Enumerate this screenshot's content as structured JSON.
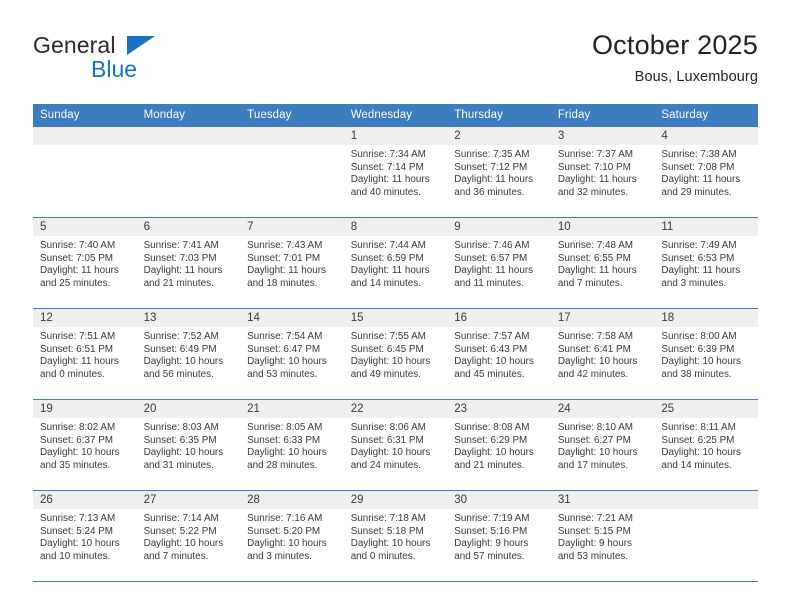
{
  "brand": {
    "name_part1": "General",
    "name_part2": "Blue",
    "triangle_icon": "triangle-icon",
    "accent_color": "#1a72c0"
  },
  "header": {
    "title": "October 2025",
    "subtitle": "Bous, Luxembourg"
  },
  "theme": {
    "header_blue": "#3c7cbf",
    "daynum_band": "#efefef",
    "text": "#3a3a3a"
  },
  "weekdays": [
    "Sunday",
    "Monday",
    "Tuesday",
    "Wednesday",
    "Thursday",
    "Friday",
    "Saturday"
  ],
  "labels": {
    "sunrise": "Sunrise:",
    "sunset": "Sunset:",
    "daylight": "Daylight:"
  },
  "weeks": [
    [
      {
        "day": "",
        "empty": true
      },
      {
        "day": "",
        "empty": true
      },
      {
        "day": "",
        "empty": true
      },
      {
        "day": "1",
        "sunrise": "Sunrise: 7:34 AM",
        "sunset": "Sunset: 7:14 PM",
        "daylight1": "Daylight: 11 hours",
        "daylight2": "and 40 minutes."
      },
      {
        "day": "2",
        "sunrise": "Sunrise: 7:35 AM",
        "sunset": "Sunset: 7:12 PM",
        "daylight1": "Daylight: 11 hours",
        "daylight2": "and 36 minutes."
      },
      {
        "day": "3",
        "sunrise": "Sunrise: 7:37 AM",
        "sunset": "Sunset: 7:10 PM",
        "daylight1": "Daylight: 11 hours",
        "daylight2": "and 32 minutes."
      },
      {
        "day": "4",
        "sunrise": "Sunrise: 7:38 AM",
        "sunset": "Sunset: 7:08 PM",
        "daylight1": "Daylight: 11 hours",
        "daylight2": "and 29 minutes."
      }
    ],
    [
      {
        "day": "5",
        "sunrise": "Sunrise: 7:40 AM",
        "sunset": "Sunset: 7:05 PM",
        "daylight1": "Daylight: 11 hours",
        "daylight2": "and 25 minutes."
      },
      {
        "day": "6",
        "sunrise": "Sunrise: 7:41 AM",
        "sunset": "Sunset: 7:03 PM",
        "daylight1": "Daylight: 11 hours",
        "daylight2": "and 21 minutes."
      },
      {
        "day": "7",
        "sunrise": "Sunrise: 7:43 AM",
        "sunset": "Sunset: 7:01 PM",
        "daylight1": "Daylight: 11 hours",
        "daylight2": "and 18 minutes."
      },
      {
        "day": "8",
        "sunrise": "Sunrise: 7:44 AM",
        "sunset": "Sunset: 6:59 PM",
        "daylight1": "Daylight: 11 hours",
        "daylight2": "and 14 minutes."
      },
      {
        "day": "9",
        "sunrise": "Sunrise: 7:46 AM",
        "sunset": "Sunset: 6:57 PM",
        "daylight1": "Daylight: 11 hours",
        "daylight2": "and 11 minutes."
      },
      {
        "day": "10",
        "sunrise": "Sunrise: 7:48 AM",
        "sunset": "Sunset: 6:55 PM",
        "daylight1": "Daylight: 11 hours",
        "daylight2": "and 7 minutes."
      },
      {
        "day": "11",
        "sunrise": "Sunrise: 7:49 AM",
        "sunset": "Sunset: 6:53 PM",
        "daylight1": "Daylight: 11 hours",
        "daylight2": "and 3 minutes."
      }
    ],
    [
      {
        "day": "12",
        "sunrise": "Sunrise: 7:51 AM",
        "sunset": "Sunset: 6:51 PM",
        "daylight1": "Daylight: 11 hours",
        "daylight2": "and 0 minutes."
      },
      {
        "day": "13",
        "sunrise": "Sunrise: 7:52 AM",
        "sunset": "Sunset: 6:49 PM",
        "daylight1": "Daylight: 10 hours",
        "daylight2": "and 56 minutes."
      },
      {
        "day": "14",
        "sunrise": "Sunrise: 7:54 AM",
        "sunset": "Sunset: 6:47 PM",
        "daylight1": "Daylight: 10 hours",
        "daylight2": "and 53 minutes."
      },
      {
        "day": "15",
        "sunrise": "Sunrise: 7:55 AM",
        "sunset": "Sunset: 6:45 PM",
        "daylight1": "Daylight: 10 hours",
        "daylight2": "and 49 minutes."
      },
      {
        "day": "16",
        "sunrise": "Sunrise: 7:57 AM",
        "sunset": "Sunset: 6:43 PM",
        "daylight1": "Daylight: 10 hours",
        "daylight2": "and 45 minutes."
      },
      {
        "day": "17",
        "sunrise": "Sunrise: 7:58 AM",
        "sunset": "Sunset: 6:41 PM",
        "daylight1": "Daylight: 10 hours",
        "daylight2": "and 42 minutes."
      },
      {
        "day": "18",
        "sunrise": "Sunrise: 8:00 AM",
        "sunset": "Sunset: 6:39 PM",
        "daylight1": "Daylight: 10 hours",
        "daylight2": "and 38 minutes."
      }
    ],
    [
      {
        "day": "19",
        "sunrise": "Sunrise: 8:02 AM",
        "sunset": "Sunset: 6:37 PM",
        "daylight1": "Daylight: 10 hours",
        "daylight2": "and 35 minutes."
      },
      {
        "day": "20",
        "sunrise": "Sunrise: 8:03 AM",
        "sunset": "Sunset: 6:35 PM",
        "daylight1": "Daylight: 10 hours",
        "daylight2": "and 31 minutes."
      },
      {
        "day": "21",
        "sunrise": "Sunrise: 8:05 AM",
        "sunset": "Sunset: 6:33 PM",
        "daylight1": "Daylight: 10 hours",
        "daylight2": "and 28 minutes."
      },
      {
        "day": "22",
        "sunrise": "Sunrise: 8:06 AM",
        "sunset": "Sunset: 6:31 PM",
        "daylight1": "Daylight: 10 hours",
        "daylight2": "and 24 minutes."
      },
      {
        "day": "23",
        "sunrise": "Sunrise: 8:08 AM",
        "sunset": "Sunset: 6:29 PM",
        "daylight1": "Daylight: 10 hours",
        "daylight2": "and 21 minutes."
      },
      {
        "day": "24",
        "sunrise": "Sunrise: 8:10 AM",
        "sunset": "Sunset: 6:27 PM",
        "daylight1": "Daylight: 10 hours",
        "daylight2": "and 17 minutes."
      },
      {
        "day": "25",
        "sunrise": "Sunrise: 8:11 AM",
        "sunset": "Sunset: 6:25 PM",
        "daylight1": "Daylight: 10 hours",
        "daylight2": "and 14 minutes."
      }
    ],
    [
      {
        "day": "26",
        "sunrise": "Sunrise: 7:13 AM",
        "sunset": "Sunset: 5:24 PM",
        "daylight1": "Daylight: 10 hours",
        "daylight2": "and 10 minutes."
      },
      {
        "day": "27",
        "sunrise": "Sunrise: 7:14 AM",
        "sunset": "Sunset: 5:22 PM",
        "daylight1": "Daylight: 10 hours",
        "daylight2": "and 7 minutes."
      },
      {
        "day": "28",
        "sunrise": "Sunrise: 7:16 AM",
        "sunset": "Sunset: 5:20 PM",
        "daylight1": "Daylight: 10 hours",
        "daylight2": "and 3 minutes."
      },
      {
        "day": "29",
        "sunrise": "Sunrise: 7:18 AM",
        "sunset": "Sunset: 5:18 PM",
        "daylight1": "Daylight: 10 hours",
        "daylight2": "and 0 minutes."
      },
      {
        "day": "30",
        "sunrise": "Sunrise: 7:19 AM",
        "sunset": "Sunset: 5:16 PM",
        "daylight1": "Daylight: 9 hours",
        "daylight2": "and 57 minutes."
      },
      {
        "day": "31",
        "sunrise": "Sunrise: 7:21 AM",
        "sunset": "Sunset: 5:15 PM",
        "daylight1": "Daylight: 9 hours",
        "daylight2": "and 53 minutes."
      },
      {
        "day": "",
        "empty": true
      }
    ]
  ]
}
